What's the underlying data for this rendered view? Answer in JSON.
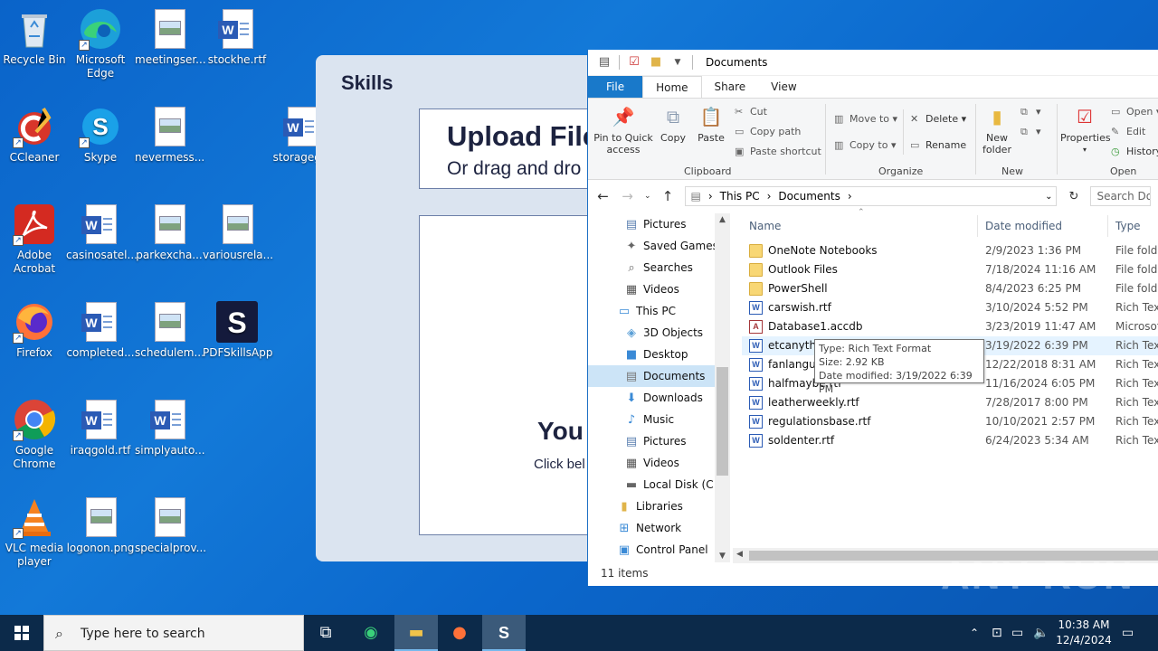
{
  "desktop": {
    "icons": [
      {
        "label": "Recycle Bin",
        "icon": "recycle-bin-icon"
      },
      {
        "label": "Microsoft Edge",
        "icon": "edge-icon"
      },
      {
        "label": "meetingser...",
        "icon": "image-file-icon"
      },
      {
        "label": "stockhe.rtf",
        "icon": "word-doc-icon"
      },
      {
        "label": "CCleaner",
        "icon": "ccleaner-icon"
      },
      {
        "label": "Skype",
        "icon": "skype-icon"
      },
      {
        "label": "nevermess...",
        "icon": "image-file-icon"
      },
      {
        "label": "storageg...",
        "icon": "word-doc-icon"
      },
      {
        "label": "Adobe Acrobat",
        "icon": "acrobat-icon"
      },
      {
        "label": "casinosatel...",
        "icon": "word-doc-icon"
      },
      {
        "label": "parkexcha...",
        "icon": "image-file-icon"
      },
      {
        "label": "variousrela...",
        "icon": "image-file-icon"
      },
      {
        "label": "Firefox",
        "icon": "firefox-icon"
      },
      {
        "label": "completed...",
        "icon": "word-doc-icon"
      },
      {
        "label": "schedulem...",
        "icon": "image-file-icon"
      },
      {
        "label": "PDFSkillsApp",
        "icon": "pdfskills-icon"
      },
      {
        "label": "Google Chrome",
        "icon": "chrome-icon"
      },
      {
        "label": "iraqgold.rtf",
        "icon": "word-doc-icon"
      },
      {
        "label": "simplyauto...",
        "icon": "word-doc-icon"
      },
      {
        "label": "VLC media player",
        "icon": "vlc-icon"
      },
      {
        "label": "logonon.png",
        "icon": "image-file-icon"
      },
      {
        "label": "specialprov...",
        "icon": "image-file-icon"
      }
    ]
  },
  "skills_app": {
    "logo": "Skills",
    "upload_title": "Upload File",
    "upload_sub": "Or drag and dro",
    "you_text": "You",
    "click_text": "Click bel"
  },
  "explorer": {
    "title": "Documents",
    "tabs": [
      "File",
      "Home",
      "Share",
      "View"
    ],
    "ribbon": {
      "pin": "Pin to Quick access",
      "copy": "Copy",
      "paste": "Paste",
      "cut": "Cut",
      "copy_path": "Copy path",
      "paste_shortcut": "Paste shortcut",
      "clipboard": "Clipboard",
      "move_to": "Move to",
      "copy_to": "Copy to",
      "delete": "Delete",
      "rename": "Rename",
      "organize": "Organize",
      "new_folder": "New folder",
      "new": "New",
      "properties": "Properties",
      "open_btn": "Open",
      "edit": "Edit",
      "history": "History",
      "open_grp": "Open"
    },
    "address": {
      "this_pc": "This PC",
      "documents": "Documents",
      "search_placeholder": "Search Do"
    },
    "nav": [
      {
        "label": "Pictures",
        "icon": "pictures-icon"
      },
      {
        "label": "Saved Games",
        "icon": "saved-games-icon"
      },
      {
        "label": "Searches",
        "icon": "searches-icon"
      },
      {
        "label": "Videos",
        "icon": "videos-icon"
      },
      {
        "label": "This PC",
        "icon": "this-pc-icon"
      },
      {
        "label": "3D Objects",
        "icon": "3d-objects-icon"
      },
      {
        "label": "Desktop",
        "icon": "desktop-icon"
      },
      {
        "label": "Documents",
        "icon": "documents-icon"
      },
      {
        "label": "Downloads",
        "icon": "downloads-icon"
      },
      {
        "label": "Music",
        "icon": "music-icon"
      },
      {
        "label": "Pictures",
        "icon": "pictures-icon"
      },
      {
        "label": "Videos",
        "icon": "videos-icon"
      },
      {
        "label": "Local Disk (C:)",
        "icon": "disk-icon"
      },
      {
        "label": "Libraries",
        "icon": "libraries-icon"
      },
      {
        "label": "Network",
        "icon": "network-icon"
      },
      {
        "label": "Control Panel",
        "icon": "control-panel-icon"
      }
    ],
    "columns": {
      "name": "Name",
      "date": "Date modified",
      "type": "Type"
    },
    "files": [
      {
        "name": "OneNote Notebooks",
        "date": "2/9/2023 1:36 PM",
        "type": "File folder",
        "kind": "folder"
      },
      {
        "name": "Outlook Files",
        "date": "7/18/2024 11:16 AM",
        "type": "File folder",
        "kind": "folder"
      },
      {
        "name": "PowerShell",
        "date": "8/4/2023 6:25 PM",
        "type": "File folder",
        "kind": "folder"
      },
      {
        "name": "carswish.rtf",
        "date": "3/10/2024 5:52 PM",
        "type": "Rich Text",
        "kind": "rtf"
      },
      {
        "name": "Database1.accdb",
        "date": "3/23/2019 11:47 AM",
        "type": "Microsoft",
        "kind": "accdb"
      },
      {
        "name": "etcanythi",
        "date": "3/19/2022 6:39 PM",
        "type": "Rich Text",
        "kind": "rtf"
      },
      {
        "name": "fanlangua",
        "date": "12/22/2018 8:31 AM",
        "type": "Rich Text",
        "kind": "rtf"
      },
      {
        "name": "halfmaybe.rtf",
        "date": "11/16/2024 6:05 PM",
        "type": "Rich Text",
        "kind": "rtf"
      },
      {
        "name": "leatherweekly.rtf",
        "date": "7/28/2017 8:00 PM",
        "type": "Rich Text",
        "kind": "rtf"
      },
      {
        "name": "regulationsbase.rtf",
        "date": "10/10/2021 2:57 PM",
        "type": "Rich Text",
        "kind": "rtf"
      },
      {
        "name": "soldenter.rtf",
        "date": "6/24/2023 5:34 AM",
        "type": "Rich Text",
        "kind": "rtf"
      }
    ],
    "status": "11 items",
    "tooltip": {
      "type": "Type: Rich Text Format",
      "size": "Size: 2.92 KB",
      "modified": "Date modified: 3/19/2022 6:39 PM"
    }
  },
  "watermark": "ANY RUN",
  "taskbar": {
    "search_placeholder": "Type here to search",
    "time": "10:38 AM",
    "date": "12/4/2024"
  }
}
